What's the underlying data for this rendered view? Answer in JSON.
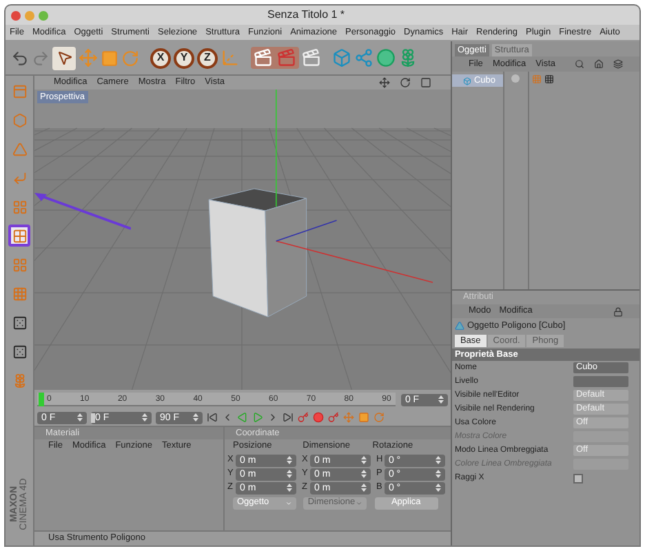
{
  "window": {
    "title": "Senza Titolo 1 *"
  },
  "menu_bar": [
    "File",
    "Modifica",
    "Oggetti",
    "Strumenti",
    "Selezione",
    "Struttura",
    "Funzioni",
    "Animazione",
    "Personaggio",
    "Dynamics",
    "Hair",
    "Rendering",
    "Plugin",
    "Finestre",
    "Aiuto"
  ],
  "toolbar": {
    "axis_buttons": [
      {
        "label": "X",
        "selected": true
      },
      {
        "label": "Y",
        "selected": true
      },
      {
        "label": "Z",
        "selected": true
      }
    ]
  },
  "tool_palette": [
    {
      "selected": false
    },
    {
      "selected": false
    },
    {
      "selected": false
    },
    {
      "selected": false
    },
    {
      "selected": false
    },
    {
      "selected": true
    },
    {
      "selected": false
    },
    {
      "selected": false
    },
    {
      "selected": false
    },
    {
      "selected": false
    },
    {
      "selected": false
    }
  ],
  "viewport": {
    "menu": [
      "Modifica",
      "Camere",
      "Mostra",
      "Filtro",
      "Vista"
    ],
    "camera_label": "Prospettiva"
  },
  "timeline": {
    "ticks": [
      "0",
      "10",
      "20",
      "30",
      "40",
      "50",
      "60",
      "70",
      "80",
      "90"
    ],
    "current_frame": "0 F"
  },
  "playback": {
    "start": "0 F",
    "position": {
      "value": "0 F",
      "level": 0
    },
    "end": "90 F"
  },
  "materials": {
    "title": "Materiali",
    "menu": [
      "File",
      "Modifica",
      "Funzione",
      "Texture"
    ]
  },
  "coordinates": {
    "title": "Coordinate",
    "columns": [
      "Posizione",
      "Dimensione",
      "Rotazione"
    ],
    "rows": [
      {
        "axes": [
          "X",
          "X",
          "H"
        ],
        "values": [
          "0 m",
          "0 m",
          "0 °"
        ]
      },
      {
        "axes": [
          "Y",
          "Y",
          "P"
        ],
        "values": [
          "0 m",
          "0 m",
          "0 °"
        ]
      },
      {
        "axes": [
          "Z",
          "Z",
          "B"
        ],
        "values": [
          "0 m",
          "0 m",
          "0 °"
        ]
      }
    ],
    "dropdowns": [
      {
        "label": "Oggetto",
        "disabled": false
      },
      {
        "label": "Dimensione",
        "disabled": true
      }
    ],
    "apply_button": "Applica"
  },
  "status_bar": "Usa Strumento Poligono",
  "logo": [
    "MAXON",
    "CINEMA 4D"
  ],
  "object_manager": {
    "tabs": [
      {
        "label": "Oggetti",
        "selected": true
      },
      {
        "label": "Struttura",
        "selected": false
      }
    ],
    "menu": [
      "File",
      "Modifica",
      "Vista"
    ],
    "objects": [
      {
        "name": "Cubo",
        "selected": true
      }
    ]
  },
  "attributes": {
    "title": "Attributi",
    "menu": [
      "Modo",
      "Modifica"
    ],
    "object_title": "Oggetto Poligono [Cubo]",
    "tabs": [
      {
        "label": "Base",
        "selected": true
      },
      {
        "label": "Coord.",
        "selected": false
      },
      {
        "label": "Phong",
        "selected": false
      }
    ],
    "section": "Proprietà Base",
    "fields": [
      {
        "label": "Nome",
        "kind": "text",
        "value": "Cubo",
        "disabled": false
      },
      {
        "label": "Livello",
        "kind": "text",
        "disabled": false
      },
      {
        "label": "Visibile nell'Editor",
        "kind": "dropdown",
        "value": "Default",
        "disabled": false
      },
      {
        "label": "Visibile nel Rendering",
        "kind": "dropdown",
        "value": "Default",
        "disabled": false
      },
      {
        "label": "Usa Colore",
        "kind": "dropdown",
        "value": "Off",
        "disabled": false
      },
      {
        "label": "Mostra Colore",
        "kind": "color",
        "disabled": true
      },
      {
        "label": "Modo Linea Ombreggiata",
        "kind": "dropdown",
        "value": "Off",
        "disabled": false
      },
      {
        "label": "Colore Linea Ombreggiata",
        "kind": "color",
        "disabled": true
      },
      {
        "label": "Raggi X",
        "kind": "checkbox",
        "checked": false,
        "disabled": false
      }
    ]
  }
}
